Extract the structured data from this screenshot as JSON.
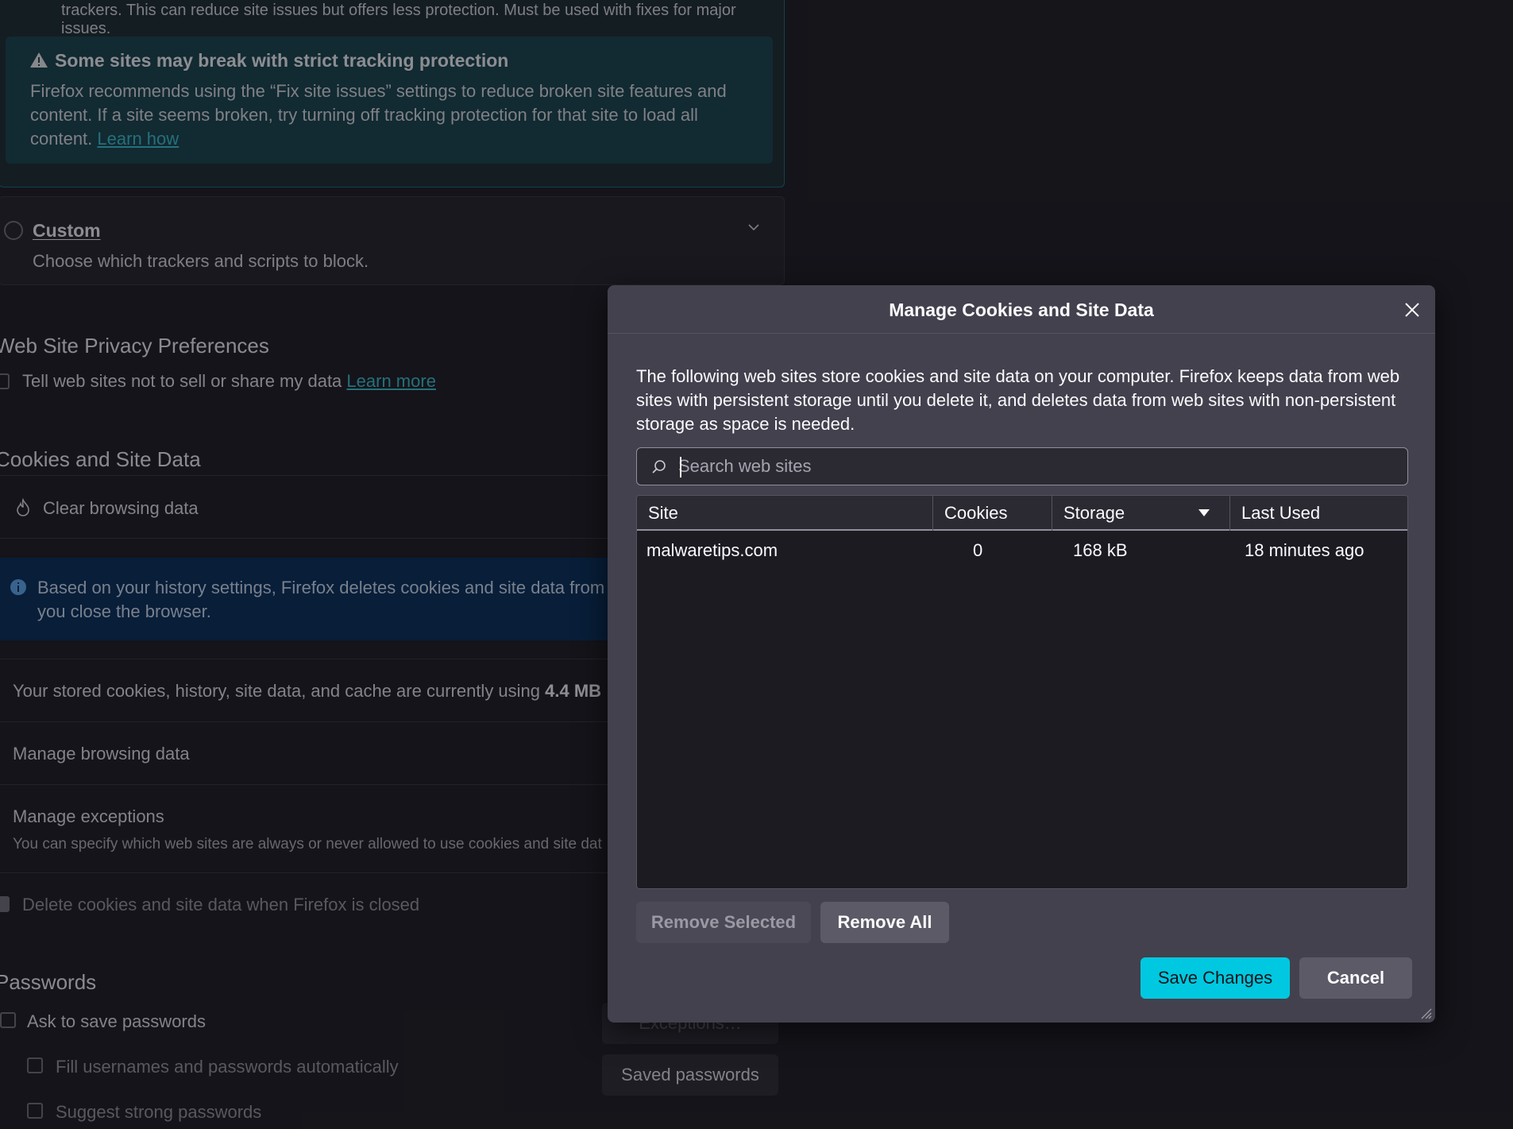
{
  "background": {
    "strict": {
      "description": "trackers. This can reduce site issues but offers less protection. Must be used with fixes for major issues.",
      "warning_title": "Some sites may break with strict tracking protection",
      "warning_text": "Firefox recommends using the “Fix site issues” settings to reduce broken site features and content. If a site seems broken, try turning off tracking protection for that site to load all content.",
      "warning_link": "Learn how"
    },
    "custom": {
      "title": "Custom",
      "description": "Choose which trackers and scripts to block."
    },
    "privacy_prefs": {
      "heading": "Web Site Privacy Preferences",
      "checkbox_label": "Tell web sites not to sell or share my data",
      "link": "Learn more"
    },
    "cookies": {
      "heading": "Cookies and Site Data",
      "clear_browsing": "Clear browsing data",
      "info_text": "Based on your history settings, Firefox deletes cookies and site data from",
      "info_text_2": "you close the browser.",
      "storage_prefix": "Your stored cookies, history, site data, and cache are currently using",
      "storage_value": "4.4 MB",
      "manage_browsing": "Manage browsing data",
      "manage_exceptions": "Manage exceptions",
      "manage_exceptions_desc": "You can specify which web sites are always or never allowed to use cookies and site dat",
      "delete_on_close": "Delete cookies and site data when Firefox is closed"
    },
    "passwords": {
      "heading": "Passwords",
      "ask_to_save": "Ask to save passwords",
      "fill_auto": "Fill usernames and passwords automatically",
      "suggest_strong": "Suggest strong passwords",
      "exceptions_button": "Exceptions…",
      "saved_button": "Saved passwords"
    }
  },
  "dialog": {
    "title": "Manage Cookies and Site Data",
    "description": "The following web sites store cookies and site data on your computer. Firefox keeps data from web sites with persistent storage until you delete it, and deletes data from web sites with non-persistent storage as space is needed.",
    "search_placeholder": "Search web sites",
    "columns": [
      "Site",
      "Cookies",
      "Storage",
      "Last Used"
    ],
    "rows": [
      {
        "site": "malwaretips.com",
        "cookies": "0",
        "storage": "168 kB",
        "last_used": "18 minutes ago"
      }
    ],
    "remove_selected": "Remove Selected",
    "remove_all": "Remove All",
    "save_changes": "Save Changes",
    "cancel": "Cancel"
  },
  "colors": {
    "accent": "#00c8e0",
    "link": "#36b9c8",
    "dialog_bg": "#42414d",
    "page_bg": "#1c1b22"
  }
}
